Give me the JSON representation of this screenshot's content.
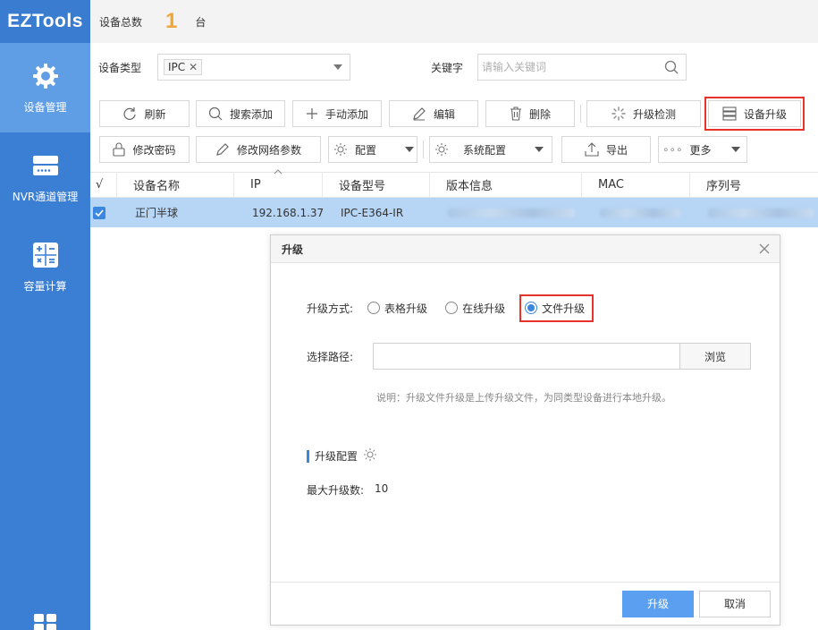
{
  "app": {
    "logo": "EZTools"
  },
  "sidebar": {
    "items": [
      {
        "label": "设备管理",
        "icon": "gear-icon",
        "active": true
      },
      {
        "label": "NVR通道管理",
        "icon": "nvr-icon",
        "active": false
      },
      {
        "label": "容量计算",
        "icon": "calculator-icon",
        "active": false
      }
    ]
  },
  "header": {
    "count_label": "设备总数",
    "count": "1",
    "unit": "台"
  },
  "filter": {
    "type_label": "设备类型",
    "type_tag": "IPC",
    "keyword_label": "关键字",
    "keyword_placeholder": "请输入关键词"
  },
  "toolbar": {
    "refresh": "刷新",
    "search_add": "搜索添加",
    "manual_add": "手动添加",
    "edit": "编辑",
    "delete": "删除",
    "upgrade_check": "升级检测",
    "device_upgrade": "设备升级",
    "change_password": "修改密码",
    "change_network": "修改网络参数",
    "config": "配置",
    "system_config": "系统配置",
    "export": "导出",
    "more_dots": "∘∘∘",
    "more": "更多"
  },
  "table": {
    "check_header": "√",
    "headers": [
      "设备名称",
      "IP",
      "设备型号",
      "版本信息",
      "MAC",
      "序列号"
    ],
    "rows": [
      {
        "name": "正门半球",
        "ip": "192.168.1.37",
        "model": "IPC-E364-IR",
        "version": "",
        "mac": "",
        "serial": ""
      }
    ]
  },
  "dialog": {
    "title": "升级",
    "method_label": "升级方式:",
    "methods": [
      "表格升级",
      "在线升级",
      "文件升级"
    ],
    "selected_method": "文件升级",
    "path_label": "选择路径:",
    "path_value": "",
    "browse": "浏览",
    "hint": "说明：升级文件升级是上传升级文件，为同类型设备进行本地升级。",
    "section_title": "升级配置",
    "max_label": "最大升级数:",
    "max_value": "10",
    "ok": "升级",
    "cancel": "取消"
  },
  "colors": {
    "sidebar": "#3b7fd4",
    "accent": "#3b87e0",
    "count": "#f0a73a",
    "highlight": "#e8332a",
    "selected_row": "#b7d5f5"
  }
}
